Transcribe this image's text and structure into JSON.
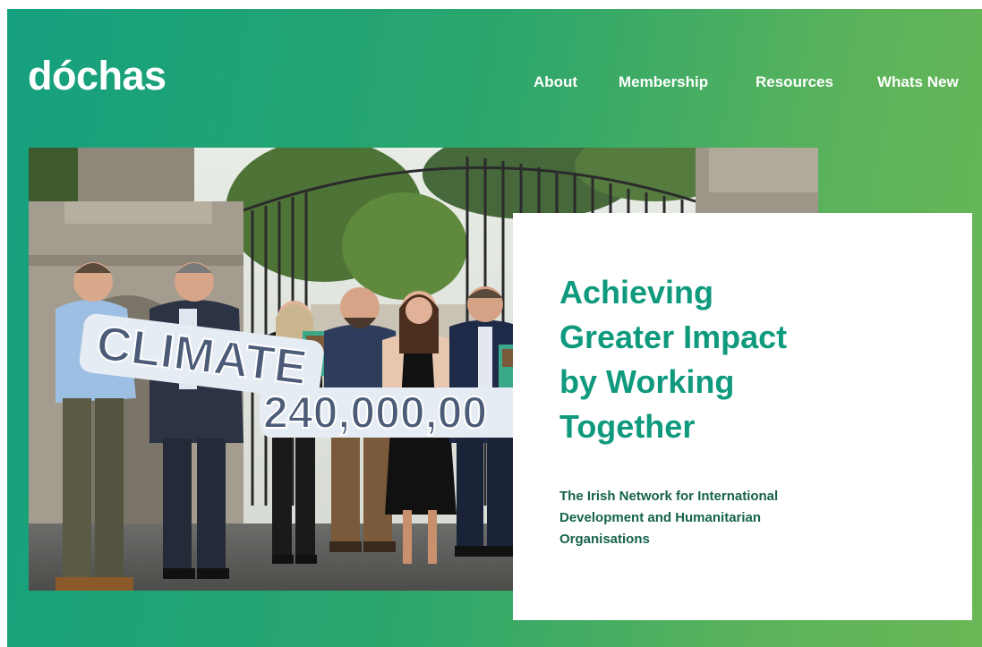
{
  "brand": {
    "logo_text": "dóchas"
  },
  "nav": {
    "items": [
      {
        "label": "About"
      },
      {
        "label": "Membership"
      },
      {
        "label": "Resources"
      },
      {
        "label": "Whats New"
      }
    ]
  },
  "hero": {
    "banner_word": "CLIMATE",
    "banner_number": "240,000,00"
  },
  "card": {
    "title_lines": [
      "Achieving",
      "Greater Impact",
      "by Working",
      "Together"
    ],
    "subtitle_lines": [
      "The Irish Network for International",
      "Development and Humanitarian",
      "Organisations"
    ]
  },
  "colors": {
    "gradient_start": "#15a07f",
    "gradient_end": "#6ab756",
    "title_color": "#0f9a7e",
    "subtitle_color": "#16624d"
  }
}
